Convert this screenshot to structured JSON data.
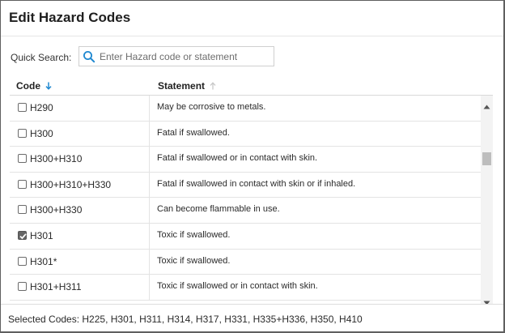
{
  "dialog": {
    "title": "Edit Hazard Codes"
  },
  "search": {
    "label": "Quick Search:",
    "placeholder": "Enter Hazard code or statement",
    "value": ""
  },
  "table": {
    "columns": {
      "code": "Code",
      "statement": "Statement"
    },
    "rows": [
      {
        "code": "H290",
        "statement": "May be corrosive to metals.",
        "checked": false
      },
      {
        "code": "H300",
        "statement": "Fatal if swallowed.",
        "checked": false
      },
      {
        "code": "H300+H310",
        "statement": "Fatal if swallowed or in contact with skin.",
        "checked": false
      },
      {
        "code": "H300+H310+H330",
        "statement": "Fatal if swallowed in contact with skin or if inhaled.",
        "checked": false
      },
      {
        "code": "H300+H330",
        "statement": "Can become flammable in use.",
        "checked": false
      },
      {
        "code": "H301",
        "statement": "Toxic if swallowed.",
        "checked": true
      },
      {
        "code": "H301*",
        "statement": "Toxic if swallowed.",
        "checked": false
      },
      {
        "code": "H301+H311",
        "statement": "Toxic if swallowed or in contact with skin.",
        "checked": false
      }
    ]
  },
  "footer": {
    "selected_codes": "Selected Codes: H225, H301, H311, H314, H317, H331, H335+H336, H350, H410"
  },
  "colors": {
    "accent": "#1f88d0",
    "checkbox_checked": "#666666"
  }
}
